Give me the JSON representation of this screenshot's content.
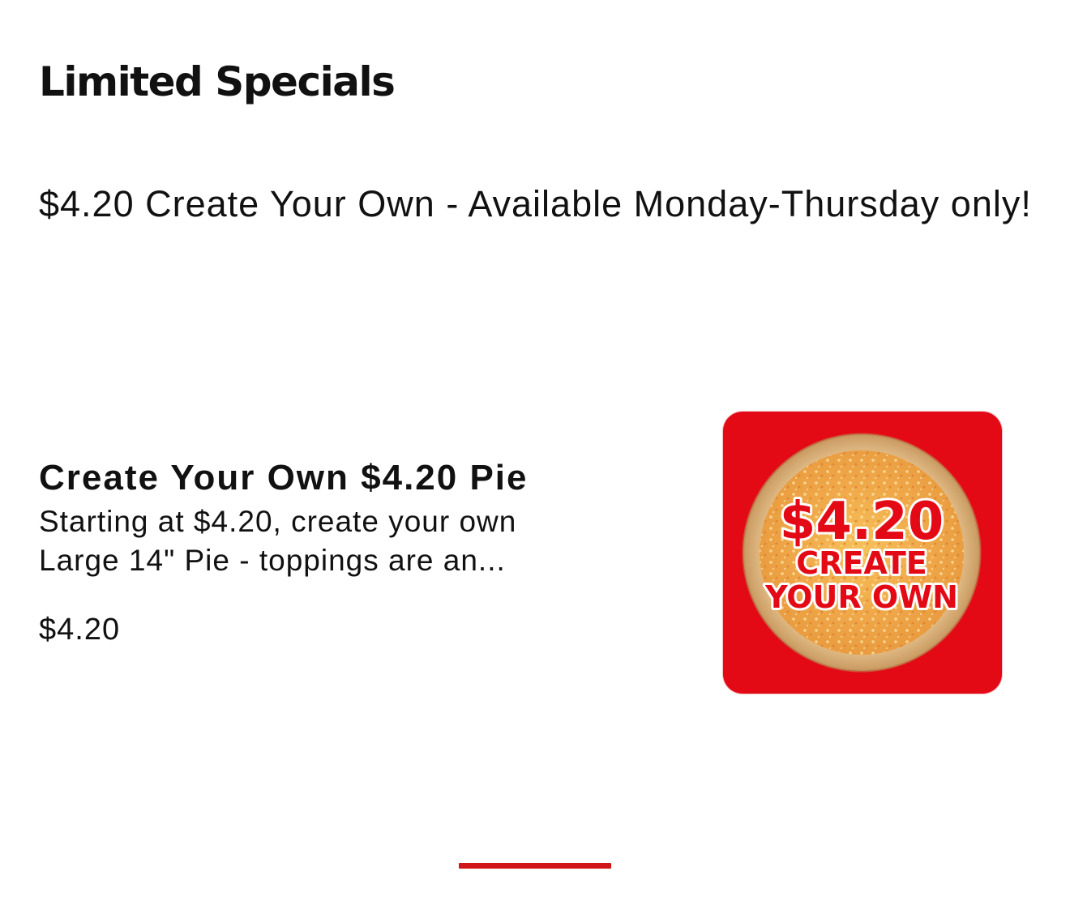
{
  "section": {
    "title": "Limited Specials",
    "description": "$4.20 Create Your Own - Available Monday-Thursday only!"
  },
  "item": {
    "title": "Create Your Own $4.20 Pie",
    "description": "Starting at $4.20, create your own Large 14\" Pie - toppings are an...",
    "price": "$4.20",
    "image": {
      "subject": "cheese-pizza-icon",
      "price_text": "$4.20",
      "line1": "CREATE",
      "line2": "YOUR OWN",
      "background": "#e30a16"
    }
  },
  "pager": {
    "color": "#d01818"
  },
  "colors": {
    "accent": "#e30a16",
    "text": "#111111",
    "background": "#ffffff"
  }
}
